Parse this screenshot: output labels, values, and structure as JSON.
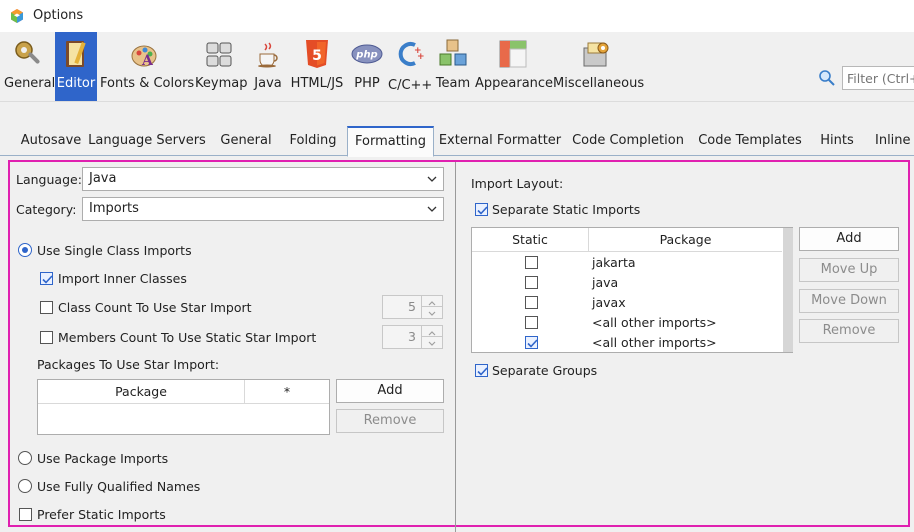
{
  "window": {
    "title": "Options",
    "app_icon": "netbeans-cube-icon"
  },
  "categories": [
    {
      "label": "General",
      "icon": "gear-wrench-icon",
      "selected": false
    },
    {
      "label": "Editor",
      "icon": "notebook-pen-icon",
      "selected": true
    },
    {
      "label": "Fonts & Colors",
      "icon": "palette-letter-icon",
      "selected": false
    },
    {
      "label": "Keymap",
      "icon": "keyboard-icon",
      "selected": false
    },
    {
      "label": "Java",
      "icon": "java-cup-icon",
      "selected": false
    },
    {
      "label": "HTML/JS",
      "icon": "html5-icon",
      "selected": false
    },
    {
      "label": "PHP",
      "icon": "php-icon",
      "selected": false
    },
    {
      "label": "C/C++",
      "icon": "cpp-icon",
      "selected": false
    },
    {
      "label": "Team",
      "icon": "team-cubes-icon",
      "selected": false
    },
    {
      "label": "Appearance",
      "icon": "appearance-layout-icon",
      "selected": false
    },
    {
      "label": "Miscellaneous",
      "icon": "misc-box-icon",
      "selected": false
    }
  ],
  "search": {
    "placeholder": "Filter (Ctrl+F)"
  },
  "tabs": [
    {
      "label": "Autosave",
      "selected": false
    },
    {
      "label": "Language Servers",
      "selected": false
    },
    {
      "label": "General",
      "selected": false
    },
    {
      "label": "Folding",
      "selected": false
    },
    {
      "label": "Formatting",
      "selected": true
    },
    {
      "label": "External Formatter",
      "selected": false
    },
    {
      "label": "Code Completion",
      "selected": false
    },
    {
      "label": "Code Templates",
      "selected": false
    },
    {
      "label": "Hints",
      "selected": false
    },
    {
      "label": "Inline Hints",
      "selected": false
    }
  ],
  "left": {
    "language_label": "Language:",
    "language_value": "Java",
    "category_label": "Category:",
    "category_value": "Imports",
    "use_single_class_imports": {
      "label": "Use Single Class Imports",
      "selected": true
    },
    "import_inner_classes": {
      "label": "Import Inner Classes",
      "checked": true
    },
    "class_count_star": {
      "label": "Class Count To Use Star Import",
      "checked": false,
      "value": "5"
    },
    "members_count_static_star": {
      "label": "Members Count To Use Static Star Import",
      "checked": false,
      "value": "3"
    },
    "packages_star_label": "Packages To Use Star Import:",
    "packages_table": {
      "columns": [
        "Package",
        "*"
      ],
      "rows": []
    },
    "add_button": "Add",
    "remove_button": "Remove",
    "use_package_imports": {
      "label": "Use Package Imports",
      "selected": false
    },
    "use_fully_qualified": {
      "label": "Use Fully Qualified Names",
      "selected": false
    },
    "prefer_static_imports": {
      "label": "Prefer Static Imports",
      "checked": false
    }
  },
  "right": {
    "import_layout_label": "Import Layout:",
    "separate_static_imports": {
      "label": "Separate Static Imports",
      "checked": true
    },
    "layout_table": {
      "columns": [
        "Static",
        "Package"
      ],
      "rows": [
        {
          "static": false,
          "package": "jakarta"
        },
        {
          "static": false,
          "package": "java"
        },
        {
          "static": false,
          "package": "javax"
        },
        {
          "static": false,
          "package": "<all other imports>"
        },
        {
          "static": true,
          "package": "<all other imports>"
        }
      ]
    },
    "add_button": "Add",
    "move_up_button": "Move Up",
    "move_down_button": "Move Down",
    "remove_button": "Remove",
    "separate_groups": {
      "label": "Separate Groups",
      "checked": true
    }
  },
  "colors": {
    "accent": "#2f65ca",
    "focus_border": "#e020b0"
  }
}
